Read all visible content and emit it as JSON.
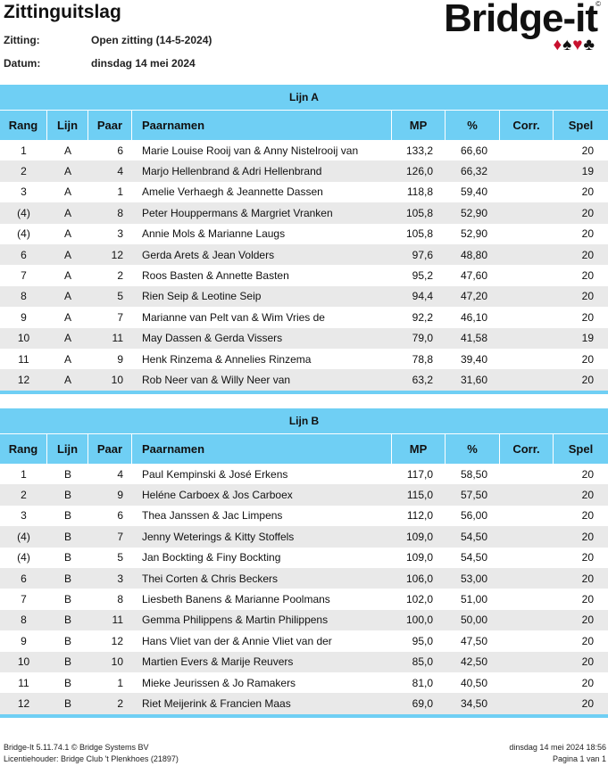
{
  "header": {
    "title": "Zittinguitslag",
    "zitting_label": "Zitting:",
    "zitting_value": "Open zitting (14-5-2024)",
    "datum_label": "Datum:",
    "datum_value": "dinsdag 14 mei 2024",
    "logo": "Bridge-it",
    "logo_mark": "©"
  },
  "columns": [
    "Rang",
    "Lijn",
    "Paar",
    "Paarnamen",
    "MP",
    "%",
    "Corr.",
    "Spel"
  ],
  "sections": [
    {
      "title": "Lijn A",
      "rows": [
        [
          "1",
          "A",
          "6",
          "Marie Louise Rooij van & Anny Nistelrooij van",
          "133,2",
          "66,60",
          "",
          "20"
        ],
        [
          "2",
          "A",
          "4",
          "Marjo Hellenbrand & Adri Hellenbrand",
          "126,0",
          "66,32",
          "",
          "19"
        ],
        [
          "3",
          "A",
          "1",
          "Amelie Verhaegh & Jeannette Dassen",
          "118,8",
          "59,40",
          "",
          "20"
        ],
        [
          "(4)",
          "A",
          "8",
          "Peter Houppermans & Margriet Vranken",
          "105,8",
          "52,90",
          "",
          "20"
        ],
        [
          "(4)",
          "A",
          "3",
          "Annie Mols & Marianne Laugs",
          "105,8",
          "52,90",
          "",
          "20"
        ],
        [
          "6",
          "A",
          "12",
          "Gerda Arets & Jean Volders",
          "97,6",
          "48,80",
          "",
          "20"
        ],
        [
          "7",
          "A",
          "2",
          "Roos Basten & Annette Basten",
          "95,2",
          "47,60",
          "",
          "20"
        ],
        [
          "8",
          "A",
          "5",
          "Rien Seip & Leotine Seip",
          "94,4",
          "47,20",
          "",
          "20"
        ],
        [
          "9",
          "A",
          "7",
          "Marianne van Pelt van & Wim Vries de",
          "92,2",
          "46,10",
          "",
          "20"
        ],
        [
          "10",
          "A",
          "11",
          "May Dassen & Gerda Vissers",
          "79,0",
          "41,58",
          "",
          "19"
        ],
        [
          "11",
          "A",
          "9",
          "Henk Rinzema & Annelies Rinzema",
          "78,8",
          "39,40",
          "",
          "20"
        ],
        [
          "12",
          "A",
          "10",
          "Rob  Neer van & Willy Neer van",
          "63,2",
          "31,60",
          "",
          "20"
        ]
      ]
    },
    {
      "title": "Lijn B",
      "rows": [
        [
          "1",
          "B",
          "4",
          "Paul Kempinski & José Erkens",
          "117,0",
          "58,50",
          "",
          "20"
        ],
        [
          "2",
          "B",
          "9",
          "Heléne Carboex & Jos Carboex",
          "115,0",
          "57,50",
          "",
          "20"
        ],
        [
          "3",
          "B",
          "6",
          "Thea Janssen & Jac Limpens",
          "112,0",
          "56,00",
          "",
          "20"
        ],
        [
          "(4)",
          "B",
          "7",
          "Jenny Weterings & Kitty Stoffels",
          "109,0",
          "54,50",
          "",
          "20"
        ],
        [
          "(4)",
          "B",
          "5",
          "Jan Bockting & Finy Bockting",
          "109,0",
          "54,50",
          "",
          "20"
        ],
        [
          "6",
          "B",
          "3",
          "Thei Corten & Chris Beckers",
          "106,0",
          "53,00",
          "",
          "20"
        ],
        [
          "7",
          "B",
          "8",
          "Liesbeth Banens & Marianne Poolmans",
          "102,0",
          "51,00",
          "",
          "20"
        ],
        [
          "8",
          "B",
          "11",
          "Gemma Philippens & Martin Philippens",
          "100,0",
          "50,00",
          "",
          "20"
        ],
        [
          "9",
          "B",
          "12",
          "Hans  Vliet van der & Annie Vliet van der",
          "95,0",
          "47,50",
          "",
          "20"
        ],
        [
          "10",
          "B",
          "10",
          "Martien Evers & Marije Reuvers",
          "85,0",
          "42,50",
          "",
          "20"
        ],
        [
          "11",
          "B",
          "1",
          "Mieke Jeurissen & Jo Ramakers",
          "81,0",
          "40,50",
          "",
          "20"
        ],
        [
          "12",
          "B",
          "2",
          "Riet Meijerink & Francien Maas",
          "69,0",
          "34,50",
          "",
          "20"
        ]
      ]
    }
  ],
  "footer": {
    "version": "Bridge-It 5.11.74.1 © Bridge Systems BV",
    "license": "Licentiehouder: Bridge Club 't Plenkhoes (21897)",
    "timestamp": "dinsdag 14 mei 2024 18:56",
    "page": "Pagina 1 van 1"
  }
}
